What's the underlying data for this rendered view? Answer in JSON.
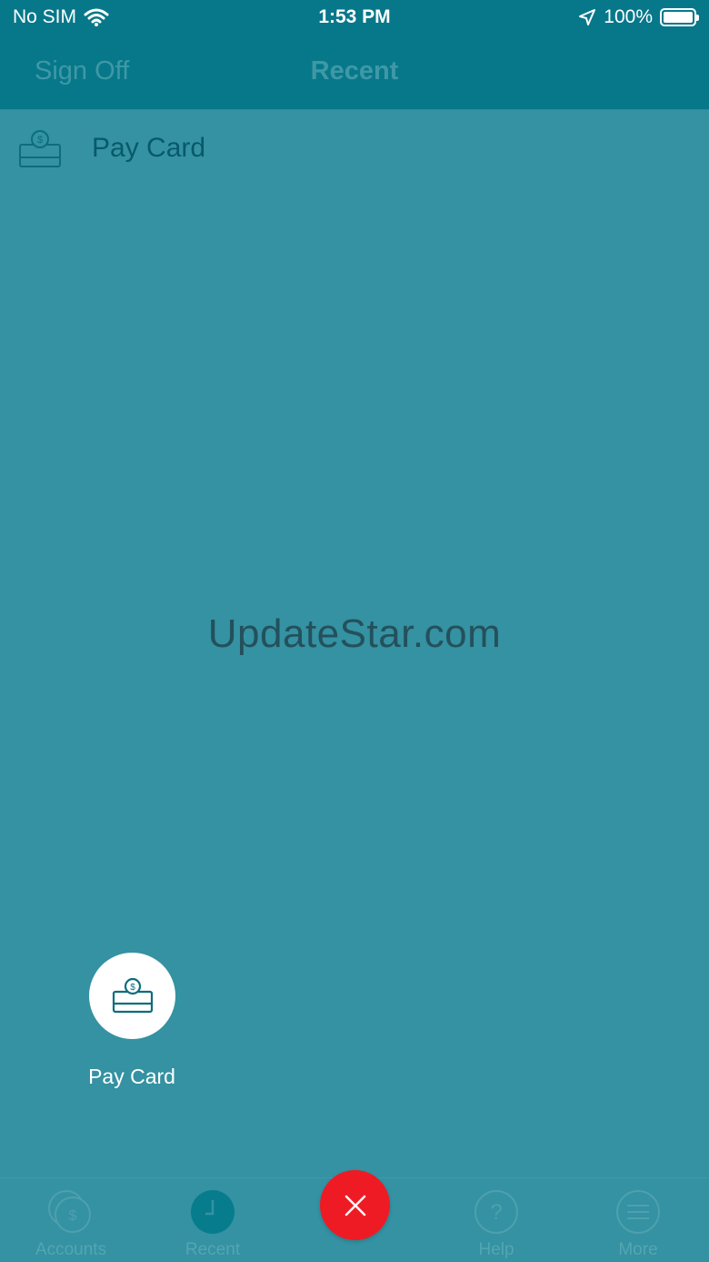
{
  "status_bar": {
    "carrier": "No SIM",
    "time": "1:53 PM",
    "battery": "100%",
    "wifi_icon": "wifi-icon",
    "location_icon": "location-arrow-icon",
    "battery_icon": "battery-icon"
  },
  "nav": {
    "left_button": "Sign Off",
    "title": "Recent"
  },
  "recent_items": [
    {
      "label": "Pay Card",
      "icon": "pay-card-icon"
    }
  ],
  "watermark": "UpdateStar.com",
  "quick_action": {
    "label": "Pay Card",
    "icon": "pay-card-icon"
  },
  "tabs": [
    {
      "label": "Accounts",
      "icon": "accounts-icon"
    },
    {
      "label": "Recent",
      "icon": "clock-icon"
    },
    {
      "label": "Help",
      "icon": "help-icon"
    },
    {
      "label": "More",
      "icon": "more-menu-icon"
    }
  ],
  "close_button": {
    "icon": "close-icon"
  },
  "colors": {
    "header": "#07788a",
    "background": "#3492a2",
    "close_red": "#ee1b25",
    "item_text": "#08596a"
  }
}
